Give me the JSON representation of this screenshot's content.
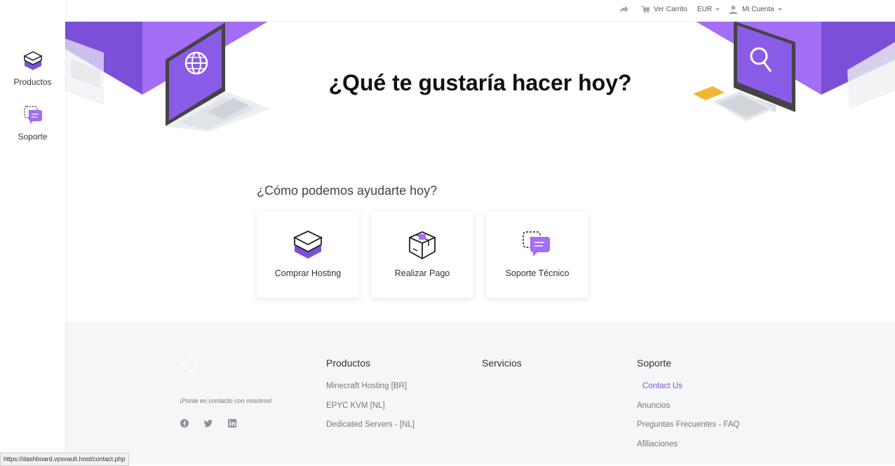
{
  "sidebar": {
    "items": [
      {
        "label": "Productos",
        "icon": "box-icon"
      },
      {
        "label": "Soporte",
        "icon": "chat-bubbles-icon"
      }
    ]
  },
  "topbar": {
    "share_icon": "share-arrow-icon",
    "cart_label": "Ver Carrito",
    "currency": "EUR",
    "account_label": "Mi Cuenta"
  },
  "hero": {
    "title": "¿Qué te gustaría hacer hoy?"
  },
  "help": {
    "title": "¿Cómo podemos ayudarte hoy?",
    "cards": [
      {
        "label": "Comprar Hosting",
        "icon": "server-box-icon"
      },
      {
        "label": "Realizar Pago",
        "icon": "payment-box-icon"
      },
      {
        "label": "Soporte Técnico",
        "icon": "support-chat-icon"
      }
    ]
  },
  "footer": {
    "contact_text": "¡Ponte en contacto con nosotros!",
    "social": [
      "facebook-icon",
      "twitter-icon",
      "linkedin-icon"
    ],
    "columns": [
      {
        "title": "Productos",
        "links": [
          "Minecraft Hosting [BR]",
          "EPYC KVM [NL]",
          "Dedicated Servers - [NL]"
        ]
      },
      {
        "title": "Servicios",
        "links": []
      },
      {
        "title": "Soporte",
        "links": [
          "Contact Us",
          "Anuncios",
          "Preguntas Frecuentes - FAQ",
          "Afiliaciones"
        ]
      }
    ]
  },
  "status_url": "https://dashboard.vpsvault.host/contact.php",
  "colors": {
    "accent": "#7b4fd8",
    "accent_light": "#a46df5",
    "footer_bg": "#f5f6f8"
  }
}
